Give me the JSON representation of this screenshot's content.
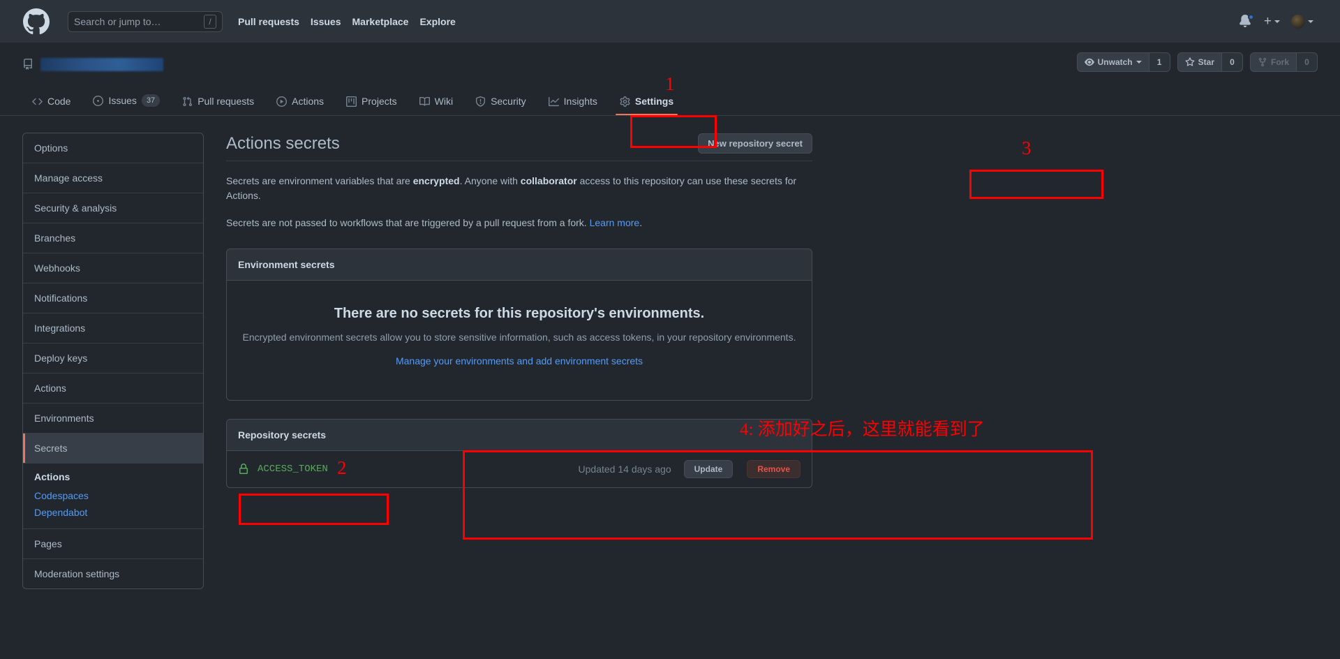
{
  "header": {
    "logo_icon": "github-mark-icon",
    "search": {
      "placeholder": "Search or jump to…",
      "shortcut_key": "/"
    },
    "nav": [
      {
        "label": "Pull requests"
      },
      {
        "label": "Issues"
      },
      {
        "label": "Marketplace"
      },
      {
        "label": "Explore"
      }
    ],
    "notifications_icon": "bell-icon",
    "create_new_icon": "plus-icon",
    "account_icon": "avatar-icon"
  },
  "repo": {
    "repo_icon": "repository-icon",
    "name_redacted": true,
    "actions": {
      "watch": {
        "label": "Unwatch",
        "count": "1",
        "icon": "eye-icon"
      },
      "star": {
        "label": "Star",
        "count": "0",
        "icon": "star-icon"
      },
      "fork": {
        "label": "Fork",
        "count": "0",
        "icon": "fork-icon"
      }
    },
    "tabs": [
      {
        "label": "Code",
        "icon": "code-icon",
        "counter": null,
        "active": false
      },
      {
        "label": "Issues",
        "icon": "issue-opened-icon",
        "counter": "37",
        "active": false
      },
      {
        "label": "Pull requests",
        "icon": "git-pull-request-icon",
        "counter": null,
        "active": false
      },
      {
        "label": "Actions",
        "icon": "play-icon",
        "counter": null,
        "active": false
      },
      {
        "label": "Projects",
        "icon": "project-icon",
        "counter": null,
        "active": false
      },
      {
        "label": "Wiki",
        "icon": "book-icon",
        "counter": null,
        "active": false
      },
      {
        "label": "Security",
        "icon": "shield-icon",
        "counter": null,
        "active": false
      },
      {
        "label": "Insights",
        "icon": "graph-icon",
        "counter": null,
        "active": false
      },
      {
        "label": "Settings",
        "icon": "gear-icon",
        "counter": null,
        "active": true
      }
    ]
  },
  "sidebar": {
    "items": [
      {
        "label": "Options",
        "selected": false
      },
      {
        "label": "Manage access",
        "selected": false
      },
      {
        "label": "Security & analysis",
        "selected": false
      },
      {
        "label": "Branches",
        "selected": false
      },
      {
        "label": "Webhooks",
        "selected": false
      },
      {
        "label": "Notifications",
        "selected": false
      },
      {
        "label": "Integrations",
        "selected": false
      },
      {
        "label": "Deploy keys",
        "selected": false
      },
      {
        "label": "Actions",
        "selected": false
      },
      {
        "label": "Environments",
        "selected": false
      },
      {
        "label": "Secrets",
        "selected": true
      }
    ],
    "secrets_group": {
      "title": "Actions",
      "links": [
        {
          "label": "Codespaces"
        },
        {
          "label": "Dependabot"
        }
      ]
    },
    "tail_items": [
      {
        "label": "Pages"
      },
      {
        "label": "Moderation settings"
      }
    ]
  },
  "main": {
    "title": "Actions secrets",
    "new_secret_button": "New repository secret",
    "description_line1_a": "Secrets are environment variables that are ",
    "description_line1_b": "encrypted",
    "description_line1_c": ". Anyone with ",
    "description_line1_d": "collaborator",
    "description_line1_e": " access to this repository can use these secrets for Actions.",
    "description_line2_a": "Secrets are not passed to workflows that are triggered by a pull request from a fork. ",
    "description_line2_link": "Learn more",
    "description_line2_b": ".",
    "environment_secrets": {
      "header": "Environment secrets",
      "empty_title": "There are no secrets for this repository's environments.",
      "empty_sub": "Encrypted environment secrets allow you to store sensitive information, such as access tokens, in your repository environments.",
      "empty_link": "Manage your environments and add environment secrets"
    },
    "repository_secrets": {
      "header": "Repository secrets",
      "rows": [
        {
          "lock_icon": "lock-icon",
          "name": "ACCESS_TOKEN",
          "updated": "Updated 14 days ago",
          "update_label": "Update",
          "remove_label": "Remove"
        }
      ]
    }
  },
  "annotations": {
    "color": "#ff0000",
    "num1": "1",
    "num2": "2",
    "num3": "3",
    "note4": "4: 添加好之后，这里就能看到了"
  }
}
